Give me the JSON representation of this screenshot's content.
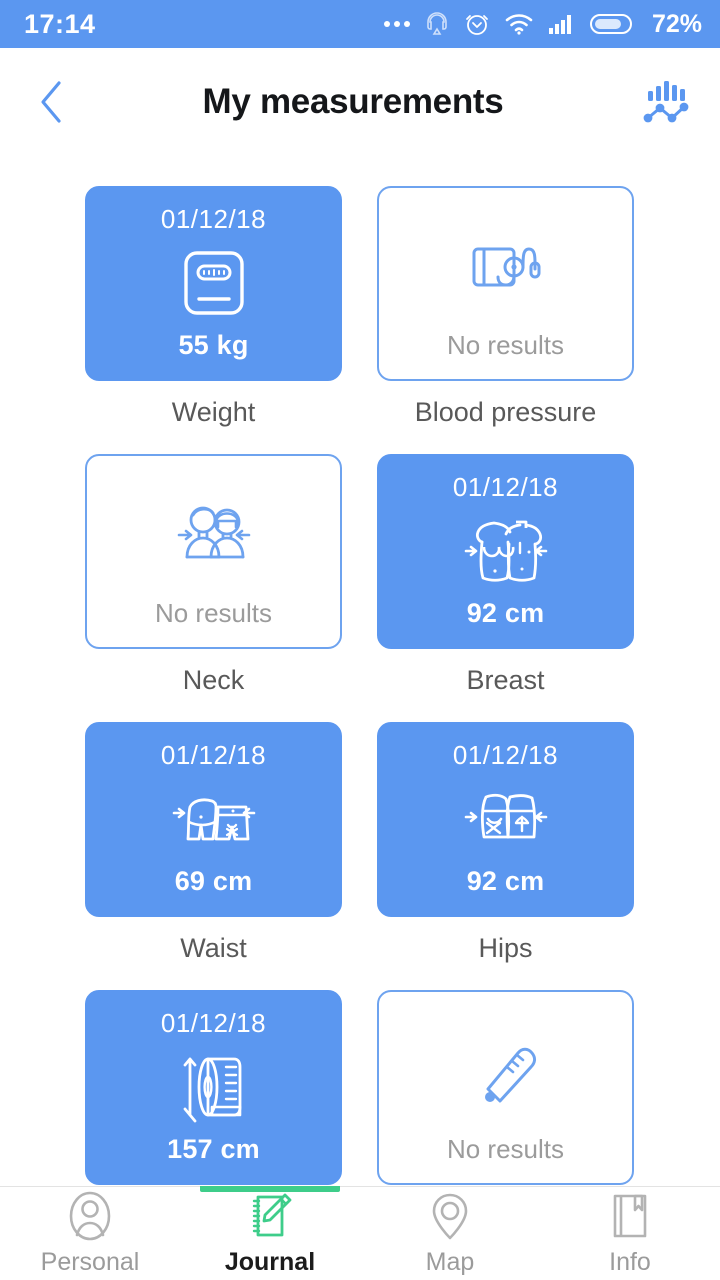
{
  "statusbar": {
    "time": "17:14",
    "battery_text": "72%",
    "battery_percent": 72,
    "icons": [
      "more-dots-icon",
      "headset-icon",
      "alarm-icon",
      "wifi-icon",
      "signal-icon",
      "battery-icon"
    ]
  },
  "header": {
    "title": "My measurements",
    "back_icon": "chevron-left-icon",
    "chart_icon": "bar-line-chart-icon"
  },
  "colors": {
    "accent_blue": "#5b97f0",
    "card_border_blue": "#6ea3ef",
    "empty_text_gray": "#9b9b9b",
    "label_gray": "#595959",
    "active_green": "#3ecd8a"
  },
  "measurements": [
    {
      "label": "Weight",
      "icon": "scale-icon",
      "state": "filled",
      "date": "01/12/18",
      "value": "55 kg"
    },
    {
      "label": "Blood pressure",
      "icon": "blood-pressure-monitor-icon",
      "state": "empty",
      "empty_text": "No results"
    },
    {
      "label": "Neck",
      "icon": "two-people-neck-icon",
      "state": "empty",
      "empty_text": "No results"
    },
    {
      "label": "Breast",
      "icon": "torso-breast-icon",
      "state": "filled",
      "date": "01/12/18",
      "value": "92 cm"
    },
    {
      "label": "Waist",
      "icon": "waist-icon",
      "state": "filled",
      "date": "01/12/18",
      "value": "69 cm"
    },
    {
      "label": "Hips",
      "icon": "hips-icon",
      "state": "filled",
      "date": "01/12/18",
      "value": "92 cm"
    },
    {
      "label": "",
      "icon": "measuring-tape-height-icon",
      "state": "filled",
      "date": "01/12/18",
      "value": "157 cm"
    },
    {
      "label": "",
      "icon": "thermometer-icon",
      "state": "empty",
      "empty_text": "No results"
    }
  ],
  "bottomnav": {
    "tabs": [
      {
        "label": "Personal",
        "icon": "person-icon",
        "active": false
      },
      {
        "label": "Journal",
        "icon": "notebook-pencil-icon",
        "active": true
      },
      {
        "label": "Map",
        "icon": "map-pin-icon",
        "active": false
      },
      {
        "label": "Info",
        "icon": "book-bookmark-icon",
        "active": false
      }
    ]
  }
}
